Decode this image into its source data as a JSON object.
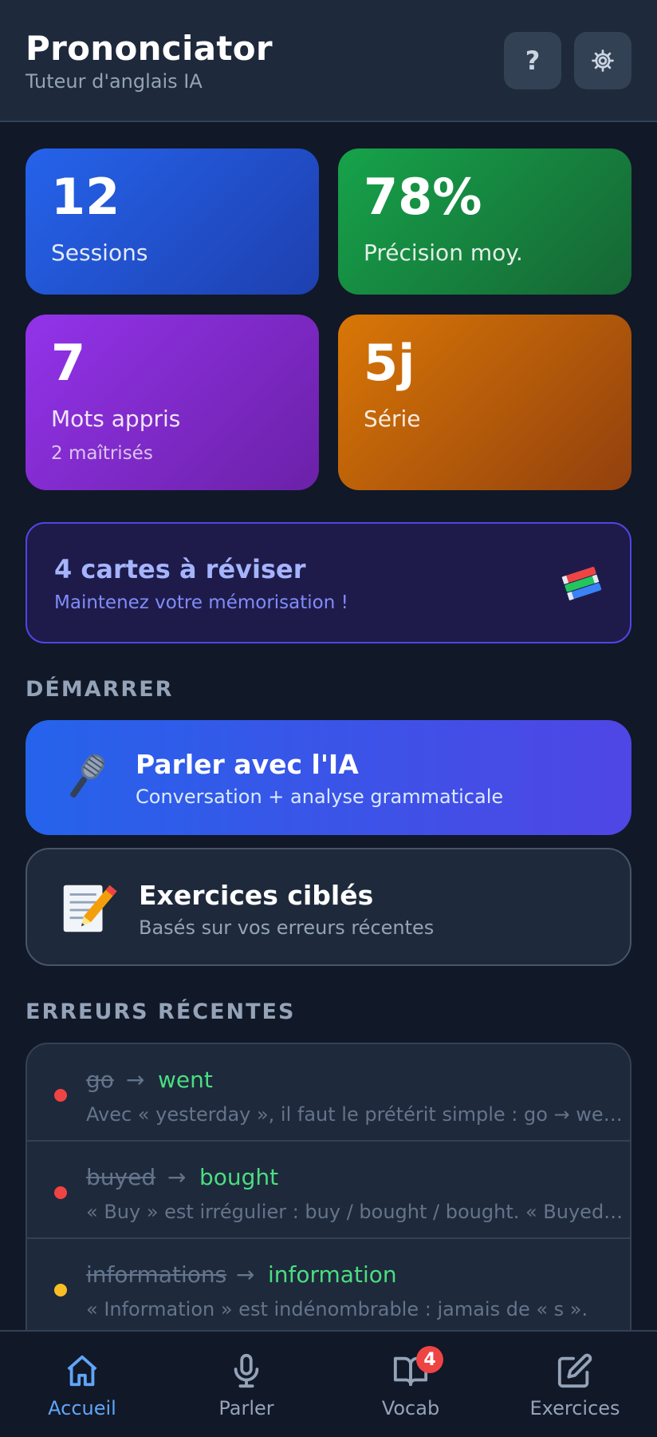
{
  "header": {
    "title": "Prononciator",
    "subtitle": "Tuteur d'anglais IA",
    "help_label": "?",
    "settings_icon": "gear-icon"
  },
  "stats": [
    {
      "value": "12",
      "label": "Sessions",
      "color": "#2563eb"
    },
    {
      "value": "78%",
      "label": "Précision moy.",
      "color": "#16a34a"
    },
    {
      "value": "7",
      "label": "Mots appris",
      "sub": "2 maîtrisés",
      "color": "#9333ea"
    },
    {
      "value": "5j",
      "label": "Série",
      "color": "#d97706"
    }
  ],
  "review": {
    "title": "4 cartes à réviser",
    "subtitle": "Maintenez votre mémorisation !",
    "icon": "books-icon"
  },
  "start_section": "DÉMARRER",
  "actions": [
    {
      "title": "Parler avec l'IA",
      "subtitle": "Conversation + analyse grammaticale",
      "icon": "microphone-icon"
    },
    {
      "title": "Exercices ciblés",
      "subtitle": "Basés sur vos erreurs récentes",
      "icon": "memo-icon"
    }
  ],
  "errors_section": "ERREURS RÉCENTES",
  "errors": [
    {
      "wrong": "go",
      "correct": "went",
      "explanation": "Avec « yesterday », il faut le prétérit simple : go → went.",
      "severity_color": "#ef4444"
    },
    {
      "wrong": "buyed",
      "correct": "bought",
      "explanation": "« Buy » est irrégulier : buy / bought / bought. « Buyed » n'existe pas.",
      "severity_color": "#ef4444"
    },
    {
      "wrong": "informations",
      "correct": "information",
      "explanation": "« Information » est indénombrable : jamais de « s ».",
      "severity_color": "#fbbf24"
    }
  ],
  "arrow": "→",
  "nav": {
    "tabs": [
      {
        "label": "Accueil",
        "icon": "home-icon",
        "active": true
      },
      {
        "label": "Parler",
        "icon": "microphone-icon",
        "active": false
      },
      {
        "label": "Vocab",
        "icon": "book-icon",
        "active": false,
        "badge": "4"
      },
      {
        "label": "Exercices",
        "icon": "edit-icon",
        "active": false
      }
    ]
  },
  "colors": {
    "background": "#111827",
    "accent": "#60a5fa",
    "correct": "#4ade80"
  }
}
